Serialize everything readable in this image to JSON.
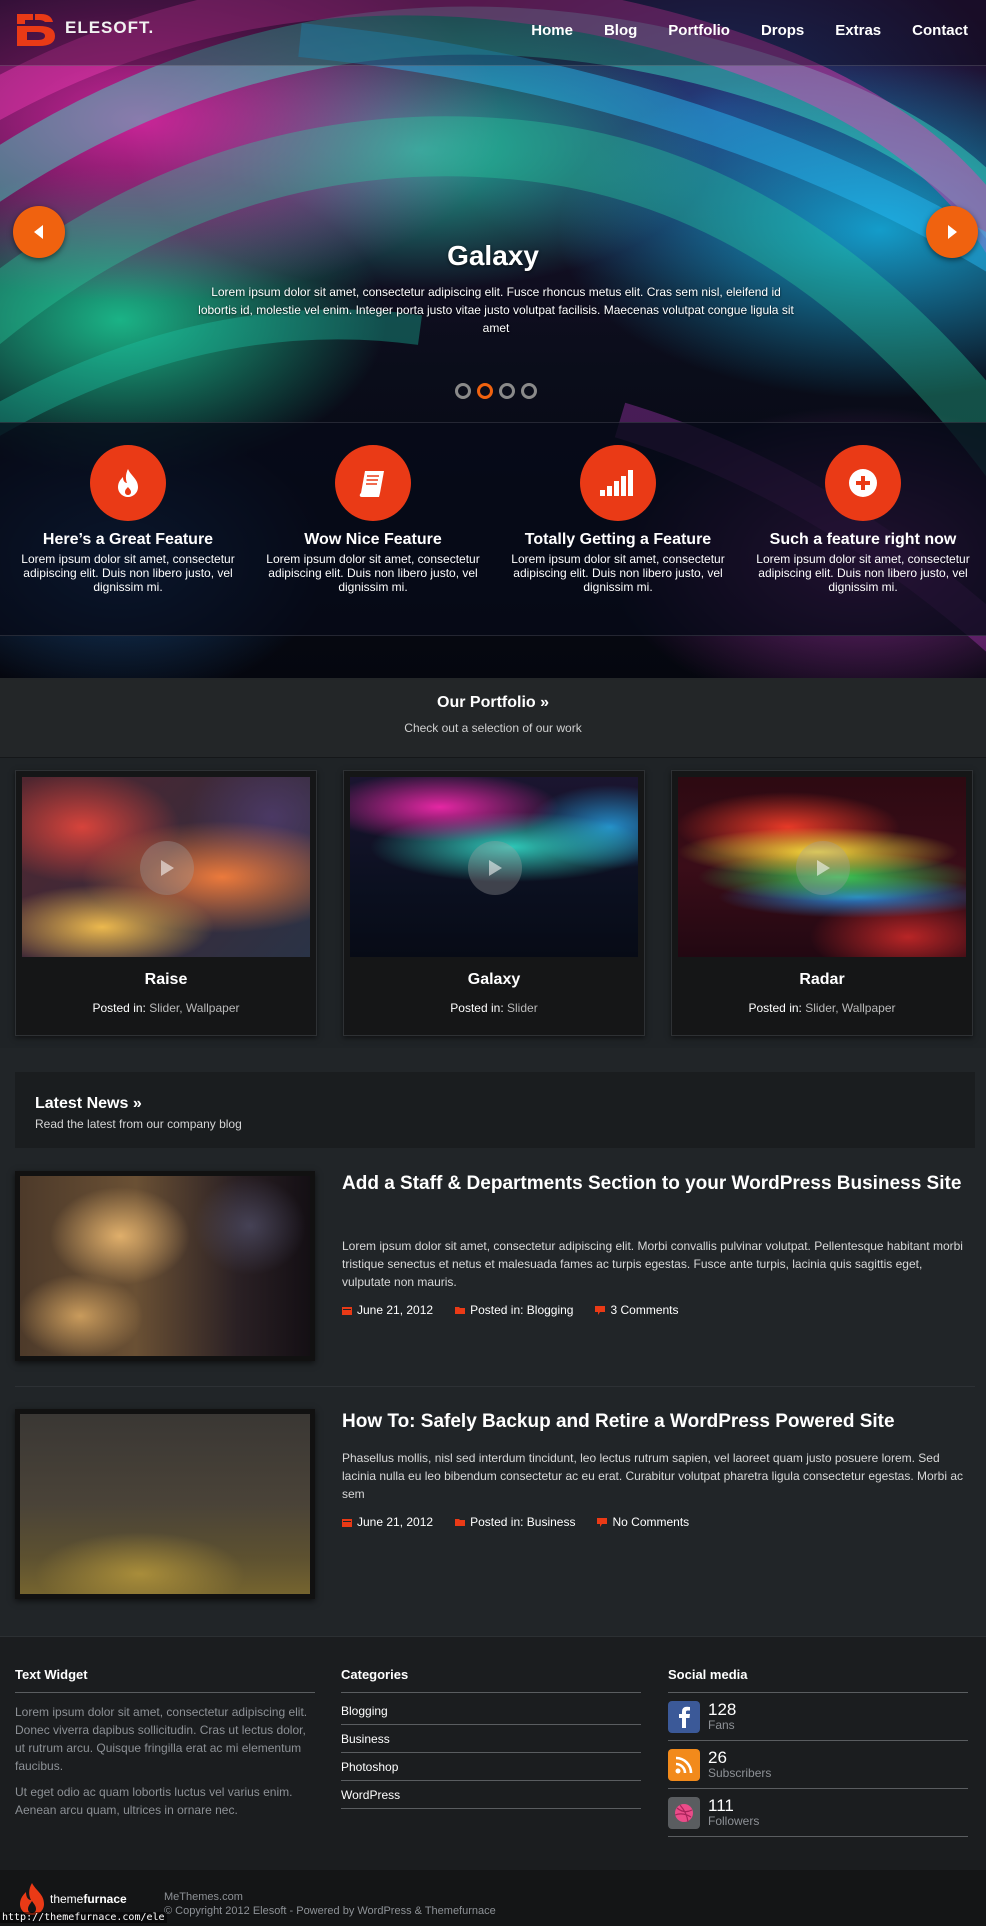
{
  "header": {
    "logo_text": "ELESOFT.",
    "nav": [
      "Home",
      "Blog",
      "Portfolio",
      "Drops",
      "Extras",
      "Contact"
    ]
  },
  "slider": {
    "title": "Galaxy",
    "text": "Lorem ipsum dolor sit amet, consectetur adipiscing elit. Fusce rhoncus metus elit. Cras sem nisl, eleifend id lobortis id, molestie vel enim. Integer porta justo vitae justo volutpat facilisis. Maecenas volutpat congue ligula sit amet",
    "slide_count": 4,
    "active_slide": 2,
    "accent": "#f0620f"
  },
  "features": [
    {
      "icon": "flame-icon",
      "title": "Here’s a Great Feature",
      "text": "Lorem ipsum dolor sit amet, consectetur adipiscing elit. Duis non libero justo, vel dignissim mi."
    },
    {
      "icon": "book-icon",
      "title": "Wow Nice Feature",
      "text": "Lorem ipsum dolor sit amet, consectetur adipiscing elit. Duis non libero justo, vel dignissim mi."
    },
    {
      "icon": "signal-bars-icon",
      "title": "Totally Getting a Feature",
      "text": "Lorem ipsum dolor sit amet, consectetur adipiscing elit. Duis non libero justo, vel dignissim mi."
    },
    {
      "icon": "plus-circle-icon",
      "title": "Such a feature right now",
      "text": "Lorem ipsum dolor sit amet, consectetur adipiscing elit. Duis non libero justo, vel dignissim mi."
    }
  ],
  "portfolio": {
    "title": "Our Portfolio »",
    "subtitle": "Check out a selection of our work",
    "posted_in_label": "Posted in:",
    "items": [
      {
        "title": "Raise",
        "categories": "Slider, Wallpaper"
      },
      {
        "title": "Galaxy",
        "categories": "Slider"
      },
      {
        "title": "Radar",
        "categories": "Slider, Wallpaper"
      }
    ]
  },
  "news": {
    "title": "Latest News »",
    "subtitle": "Read the latest from our company blog",
    "posts": [
      {
        "title": "Add a Staff & Departments Section to your WordPress Business Site",
        "excerpt": "Lorem ipsum dolor sit amet, consectetur adipiscing elit. Morbi convallis pulvinar volutpat. Pellentesque habitant morbi tristique senectus et netus et malesuada fames ac turpis egestas. Fusce ante turpis, lacinia quis sagittis eget, vulputate non mauris.",
        "date": "June 21, 2012",
        "category": "Posted in: Blogging",
        "comments": "3 Comments"
      },
      {
        "title": "How To: Safely Backup and Retire a WordPress Powered Site",
        "excerpt": "Phasellus mollis, nisl sed interdum tincidunt, leo lectus rutrum sapien, vel laoreet quam justo posuere lorem. Sed lacinia nulla eu leo bibendum consectetur ac eu erat. Curabitur volutpat pharetra ligula consectetur egestas. Morbi ac sem",
        "date": "June 21, 2012",
        "category": "Posted in: Business",
        "comments": "No Comments"
      }
    ]
  },
  "footer": {
    "text_widget": {
      "heading": "Text Widget",
      "p1": "Lorem ipsum dolor sit amet, consectetur adipiscing elit. Donec viverra dapibus sollicitudin. Cras ut lectus dolor, ut rutrum arcu. Quisque fringilla erat ac mi elementum faucibus.",
      "p2": "Ut eget odio ac quam lobortis luctus vel varius enim. Aenean arcu quam, ultrices in ornare nec."
    },
    "categories": {
      "heading": "Categories",
      "items": [
        "Blogging",
        "Business",
        "Photoshop",
        "WordPress"
      ]
    },
    "social": {
      "heading": "Social media",
      "items": [
        {
          "icon": "facebook-icon",
          "count": "128",
          "label": "Fans"
        },
        {
          "icon": "rss-icon",
          "count": "26",
          "label": "Subscribers"
        },
        {
          "icon": "dribbble-icon",
          "count": "111",
          "label": "Followers"
        }
      ]
    }
  },
  "bottom": {
    "brand_light": "theme",
    "brand_bold": "furnace",
    "line1": "MeThemes.com",
    "line2": "© Copyright 2012 Elesoft - Powered by WordPress & Themefurnace",
    "status_url": "http://themefurnace.com/ele"
  }
}
